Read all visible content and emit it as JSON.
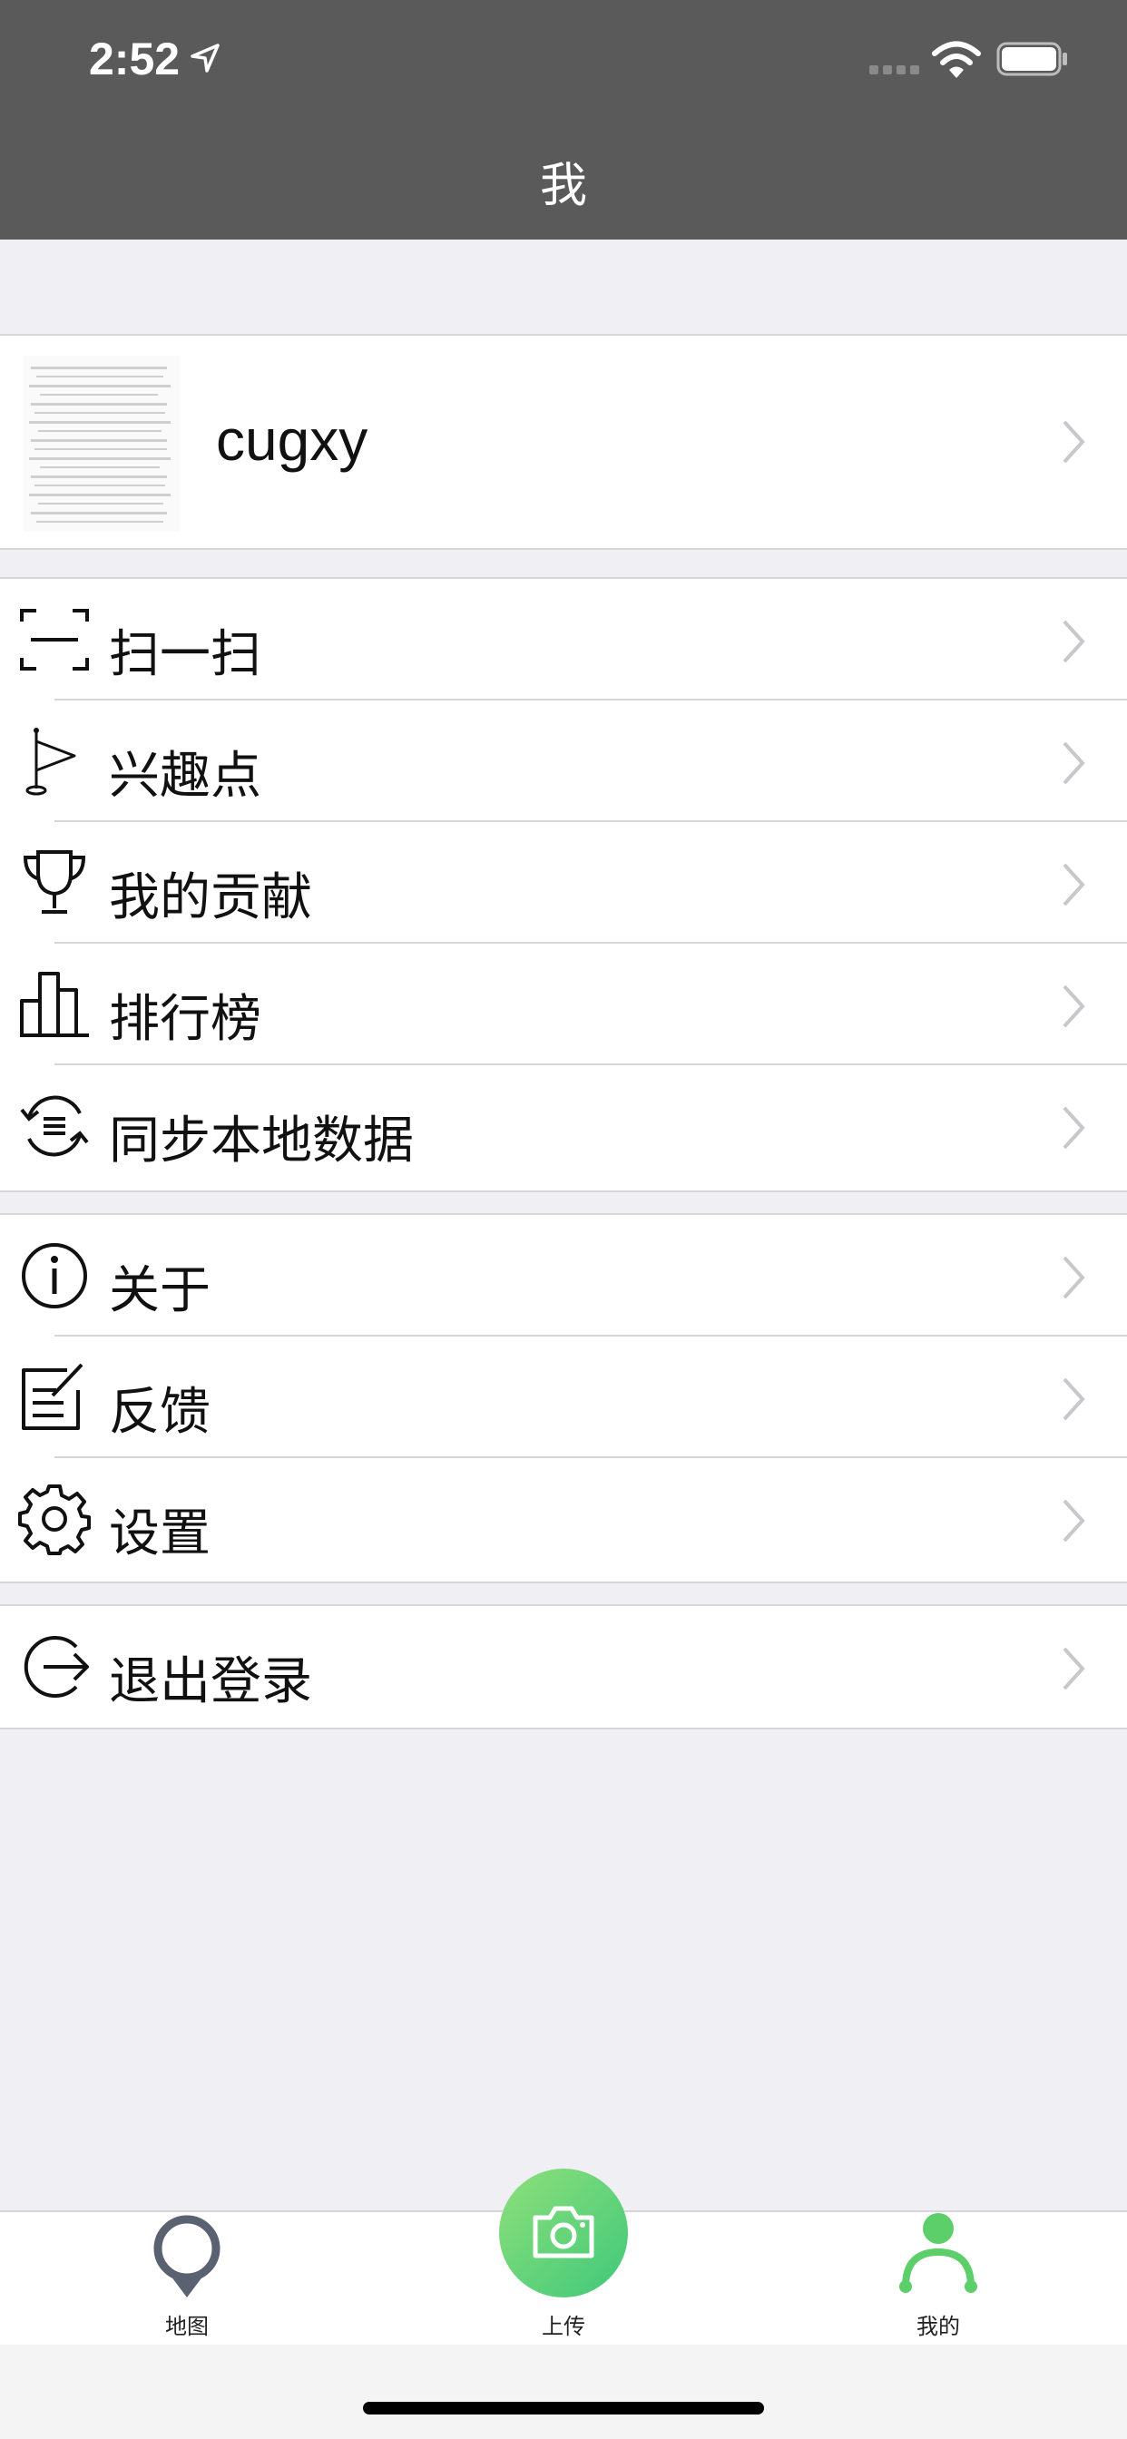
{
  "status": {
    "time": "2:52"
  },
  "nav": {
    "title": "我"
  },
  "profile": {
    "username": "cugxy"
  },
  "menu_group1": [
    {
      "label": "扫一扫",
      "icon": "scan-icon"
    },
    {
      "label": "兴趣点",
      "icon": "flag-icon"
    },
    {
      "label": "我的贡献",
      "icon": "trophy-icon"
    },
    {
      "label": "排行榜",
      "icon": "bar-chart-icon"
    },
    {
      "label": "同步本地数据",
      "icon": "sync-icon"
    }
  ],
  "menu_group2": [
    {
      "label": "关于",
      "icon": "info-icon"
    },
    {
      "label": "反馈",
      "icon": "feedback-icon"
    },
    {
      "label": "设置",
      "icon": "gear-icon"
    }
  ],
  "menu_group3": [
    {
      "label": "退出登录",
      "icon": "logout-icon"
    }
  ],
  "tabs": {
    "map": "地图",
    "upload": "上传",
    "mine": "我的"
  },
  "colors": {
    "header": "#5a5a5a",
    "accent": "#5ccf6a",
    "background": "#efeff4"
  }
}
